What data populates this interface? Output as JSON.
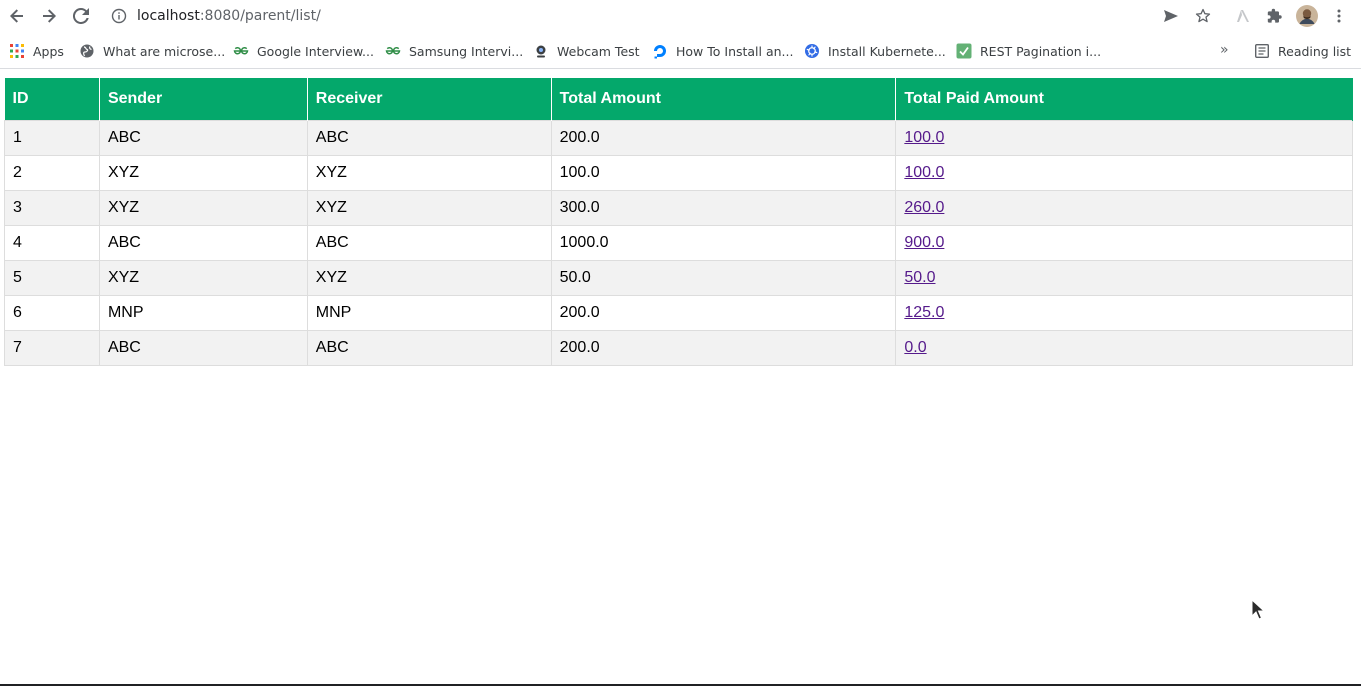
{
  "browser": {
    "url_host": "localhost",
    "url_rest": ":8080/parent/list/"
  },
  "bookmarks": {
    "items": [
      {
        "label": "Apps",
        "icon": "apps-grid-icon"
      },
      {
        "label": "What are microse...",
        "icon": "globe-icon"
      },
      {
        "label": "Google Interview...",
        "icon": "geeksforgeeks-icon"
      },
      {
        "label": "Samsung Intervi...",
        "icon": "geeksforgeeks-icon"
      },
      {
        "label": "Webcam Test",
        "icon": "webcam-icon"
      },
      {
        "label": "How To Install an...",
        "icon": "digitalocean-icon"
      },
      {
        "label": "Install Kubernete...",
        "icon": "kubernetes-icon"
      },
      {
        "label": "REST Pagination i...",
        "icon": "baeldung-icon"
      }
    ],
    "overflow": "»",
    "reading_list": "Reading list"
  },
  "table": {
    "headers": [
      "ID",
      "Sender",
      "Receiver",
      "Total Amount",
      "Total Paid Amount"
    ],
    "rows": [
      {
        "id": "1",
        "sender": "ABC",
        "receiver": "ABC",
        "total": "200.0",
        "paid": "100.0"
      },
      {
        "id": "2",
        "sender": "XYZ",
        "receiver": "XYZ",
        "total": "100.0",
        "paid": "100.0"
      },
      {
        "id": "3",
        "sender": "XYZ",
        "receiver": "XYZ",
        "total": "300.0",
        "paid": "260.0"
      },
      {
        "id": "4",
        "sender": "ABC",
        "receiver": "ABC",
        "total": "1000.0",
        "paid": "900.0"
      },
      {
        "id": "5",
        "sender": "XYZ",
        "receiver": "XYZ",
        "total": "50.0",
        "paid": "50.0"
      },
      {
        "id": "6",
        "sender": "MNP",
        "receiver": "MNP",
        "total": "200.0",
        "paid": "125.0"
      },
      {
        "id": "7",
        "sender": "ABC",
        "receiver": "ABC",
        "total": "200.0",
        "paid": "0.0"
      }
    ]
  },
  "colors": {
    "header_bg": "#04a86b",
    "link": "#551a8b",
    "row_alt": "#f2f2f2"
  }
}
